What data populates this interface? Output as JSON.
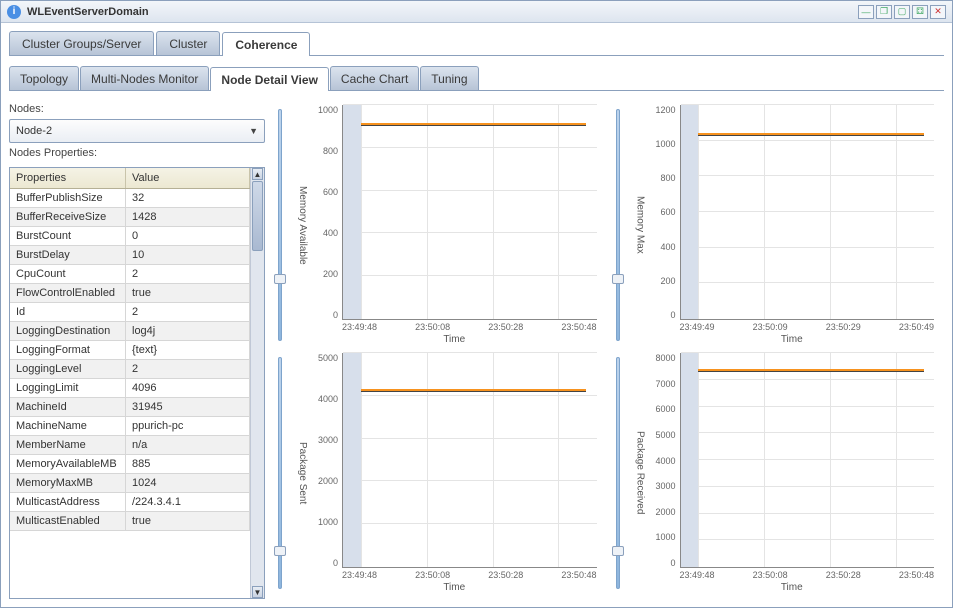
{
  "window": {
    "title": "WLEventServerDomain"
  },
  "outer_tabs": [
    {
      "label": "Cluster Groups/Server",
      "active": false
    },
    {
      "label": "Cluster",
      "active": false
    },
    {
      "label": "Coherence",
      "active": true
    }
  ],
  "inner_tabs": [
    {
      "label": "Topology",
      "active": false
    },
    {
      "label": "Multi-Nodes Monitor",
      "active": false
    },
    {
      "label": "Node Detail View",
      "active": true
    },
    {
      "label": "Cache Chart",
      "active": false
    },
    {
      "label": "Tuning",
      "active": false
    }
  ],
  "left": {
    "nodes_label": "Nodes:",
    "selected_node": "Node-2",
    "props_label": "Nodes Properties:",
    "columns": {
      "prop": "Properties",
      "val": "Value"
    },
    "rows": [
      {
        "prop": "BufferPublishSize",
        "val": "32"
      },
      {
        "prop": "BufferReceiveSize",
        "val": "1428"
      },
      {
        "prop": "BurstCount",
        "val": "0"
      },
      {
        "prop": "BurstDelay",
        "val": "10"
      },
      {
        "prop": "CpuCount",
        "val": "2"
      },
      {
        "prop": "FlowControlEnabled",
        "val": "true"
      },
      {
        "prop": "Id",
        "val": "2"
      },
      {
        "prop": "LoggingDestination",
        "val": "log4j"
      },
      {
        "prop": "LoggingFormat",
        "val": "{text}"
      },
      {
        "prop": "LoggingLevel",
        "val": "2"
      },
      {
        "prop": "LoggingLimit",
        "val": "4096"
      },
      {
        "prop": "MachineId",
        "val": "31945"
      },
      {
        "prop": "MachineName",
        "val": "ppurich-pc"
      },
      {
        "prop": "MemberName",
        "val": "n/a"
      },
      {
        "prop": "MemoryAvailableMB",
        "val": "885"
      },
      {
        "prop": "MemoryMaxMB",
        "val": "1024"
      },
      {
        "prop": "MulticastAddress",
        "val": "/224.3.4.1"
      },
      {
        "prop": "MulticastEnabled",
        "val": "true"
      }
    ]
  },
  "charts": {
    "xlabel": "Time",
    "items": [
      {
        "id": "mem-avail",
        "ylabel": "Memory Available",
        "ymin": 0,
        "ymax": 1000,
        "ystep": 200,
        "xticks": [
          "23:49:48",
          "23:50:08",
          "23:50:28",
          "23:50:48"
        ],
        "level_frac": 0.9
      },
      {
        "id": "mem-max",
        "ylabel": "Memory Max",
        "ymin": 0,
        "ymax": 1200,
        "ystep": 200,
        "xticks": [
          "23:49:49",
          "23:50:09",
          "23:50:29",
          "23:50:49"
        ],
        "level_frac": 0.853
      },
      {
        "id": "pkg-sent",
        "ylabel": "Package Sent",
        "ymin": 0,
        "ymax": 5000,
        "ystep": 1000,
        "xticks": [
          "23:49:48",
          "23:50:08",
          "23:50:28",
          "23:50:48"
        ],
        "level_frac": 0.82
      },
      {
        "id": "pkg-recv",
        "ylabel": "Package Received",
        "ymin": 0,
        "ymax": 8000,
        "ystep": 1000,
        "xticks": [
          "23:49:48",
          "23:50:08",
          "23:50:28",
          "23:50:48"
        ],
        "level_frac": 0.91
      }
    ]
  },
  "chart_data": [
    {
      "type": "line",
      "title": "Memory Available",
      "xlabel": "Time",
      "ylabel": "Memory Available",
      "ylim": [
        0,
        1000
      ],
      "x": [
        "23:49:48",
        "23:50:08",
        "23:50:28",
        "23:50:48"
      ],
      "values": [
        900,
        895,
        895,
        890
      ]
    },
    {
      "type": "line",
      "title": "Memory Max",
      "xlabel": "Time",
      "ylabel": "Memory Max",
      "ylim": [
        0,
        1200
      ],
      "x": [
        "23:49:49",
        "23:50:09",
        "23:50:29",
        "23:50:49"
      ],
      "values": [
        1024,
        1024,
        1024,
        1024
      ]
    },
    {
      "type": "line",
      "title": "Package Sent",
      "xlabel": "Time",
      "ylabel": "Package Sent",
      "ylim": [
        0,
        5000
      ],
      "x": [
        "23:49:48",
        "23:50:08",
        "23:50:28",
        "23:50:48"
      ],
      "values": [
        4050,
        4100,
        4150,
        4200
      ]
    },
    {
      "type": "line",
      "title": "Package Received",
      "xlabel": "Time",
      "ylabel": "Package Received",
      "ylim": [
        0,
        8000
      ],
      "x": [
        "23:49:48",
        "23:50:08",
        "23:50:28",
        "23:50:48"
      ],
      "values": [
        7200,
        7300,
        7350,
        7400
      ]
    }
  ]
}
